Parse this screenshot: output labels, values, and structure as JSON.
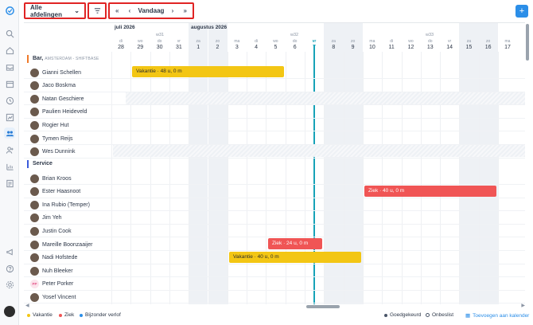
{
  "toolbar": {
    "department": "Alle afdelingen",
    "today_label": "Vandaag"
  },
  "months": [
    "juli 2026",
    "augustus 2026"
  ],
  "weeks": [
    "w31",
    "w32",
    "w33"
  ],
  "days": [
    {
      "wd": "di",
      "num": "28"
    },
    {
      "wd": "wo",
      "num": "29"
    },
    {
      "wd": "do",
      "num": "30"
    },
    {
      "wd": "vr",
      "num": "31"
    },
    {
      "wd": "za",
      "num": "1"
    },
    {
      "wd": "zo",
      "num": "2"
    },
    {
      "wd": "ma",
      "num": "3"
    },
    {
      "wd": "di",
      "num": "4"
    },
    {
      "wd": "wo",
      "num": "5"
    },
    {
      "wd": "do",
      "num": "6"
    },
    {
      "wd": "vr",
      "num": "7"
    },
    {
      "wd": "za",
      "num": "8"
    },
    {
      "wd": "zo",
      "num": "9"
    },
    {
      "wd": "ma",
      "num": "10"
    },
    {
      "wd": "di",
      "num": "11"
    },
    {
      "wd": "wo",
      "num": "12"
    },
    {
      "wd": "do",
      "num": "13"
    },
    {
      "wd": "vr",
      "num": "14"
    },
    {
      "wd": "za",
      "num": "15"
    },
    {
      "wd": "zo",
      "num": "16"
    },
    {
      "wd": "ma",
      "num": "17"
    }
  ],
  "sections": {
    "bar": {
      "name": "Bar,",
      "sub": "AMSTERDAM - SHIFTBASE",
      "color": "#f07a2a"
    },
    "service": {
      "name": "Service",
      "color": "#3b5bdb"
    }
  },
  "employees_bar": [
    "Gianni Schellen",
    "Jaco Boskma",
    "Natan Geschiere",
    "Paulien Heideveld",
    "Rogier Hut",
    "Tymen Reijs",
    "Wes Dunnink"
  ],
  "employees_service": [
    "Brian Kroos",
    "Ester Haasnoot",
    "Ina Rubio (Temper)",
    "Jim Yeh",
    "Justin Cook",
    "Mareille Boonzaaijer",
    "Nadi Hofstede",
    "Nuh Bleeker",
    "Peter Porker",
    "Yosef Vincent"
  ],
  "avatar_initials": "PP",
  "absences": {
    "gianni": "Vakantie · 48 u, 0 m",
    "ester": "Ziek · 40 u, 0 m",
    "mareille": "Ziek · 24 u, 0 m",
    "nadi": "Vakantie · 40 u, 0 m"
  },
  "legend": {
    "vakantie": "Vakantie",
    "ziek": "Ziek",
    "bijzonder": "Bijzonder verlof",
    "goedgekeurd": "Goedgekeurd",
    "onbeslist": "Onbeslist",
    "calendar_link": "Toevoegen aan kalender"
  },
  "colors": {
    "vakantie": "#f3c614",
    "ziek": "#f05555",
    "bijzonder": "#2b8ee8",
    "today": "#17a2b8"
  }
}
